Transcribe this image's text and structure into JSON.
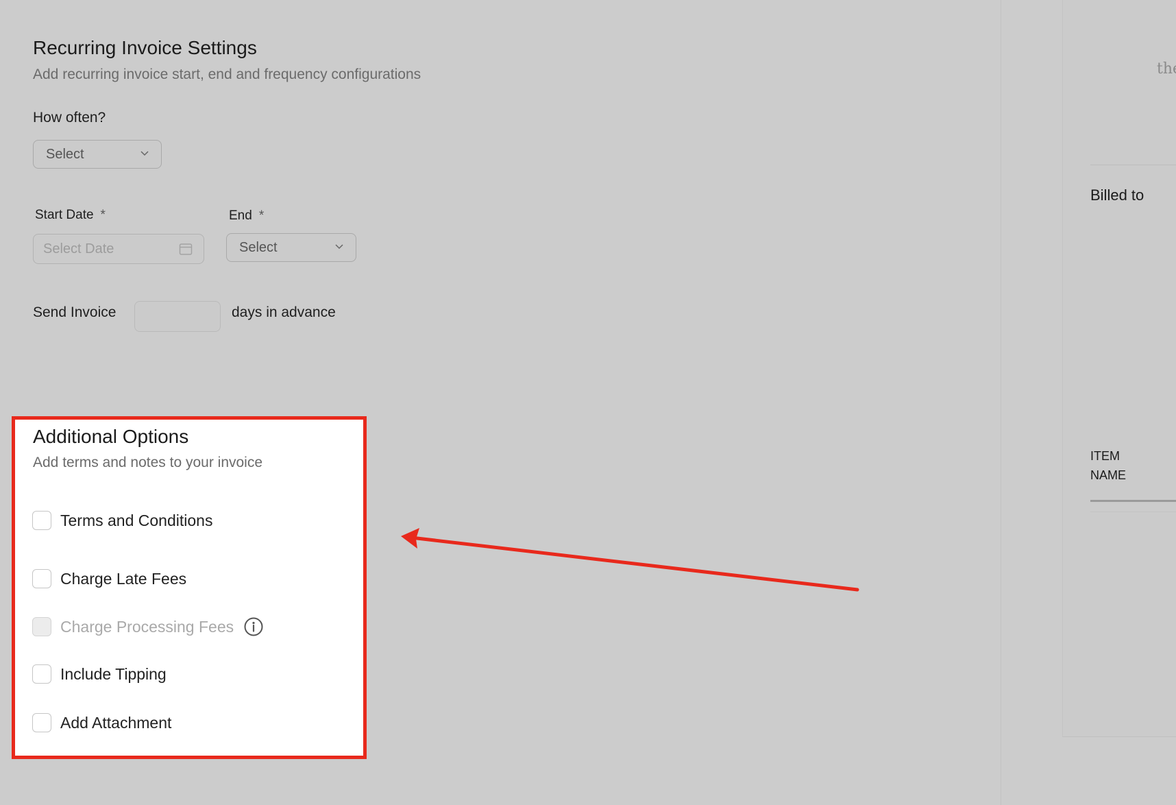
{
  "recurring": {
    "title": "Recurring Invoice Settings",
    "subtitle": "Add recurring invoice start, end and frequency configurations",
    "how_often_label": "How often?",
    "how_often_value": "Select",
    "start_date_label": "Start Date",
    "start_date_placeholder": "Select Date",
    "end_label": "End",
    "end_value": "Select",
    "required_mark": "*",
    "send_invoice_label": "Send Invoice",
    "days_in_advance_label": "days in advance",
    "days_value": ""
  },
  "additional_options": {
    "title": "Additional Options",
    "subtitle": "Add terms and notes to your invoice",
    "items": [
      {
        "label": "Terms and Conditions",
        "checked": false,
        "disabled": false
      },
      {
        "label": "Charge Late Fees",
        "checked": false,
        "disabled": false
      },
      {
        "label": "Charge Processing Fees",
        "checked": false,
        "disabled": true
      },
      {
        "label": "Include Tipping",
        "checked": false,
        "disabled": false
      },
      {
        "label": "Add Attachment",
        "checked": false,
        "disabled": false
      }
    ]
  },
  "preview": {
    "partial_text": "the",
    "billed_to_label": "Billed to",
    "item_name_header_line1": "ITEM",
    "item_name_header_line2": "NAME"
  },
  "icons": {
    "dropdown": "chevron-down-icon",
    "calendar": "calendar-icon",
    "info": "info-icon"
  },
  "colors": {
    "highlight": "#e8291c",
    "page_background": "#cccccc"
  }
}
